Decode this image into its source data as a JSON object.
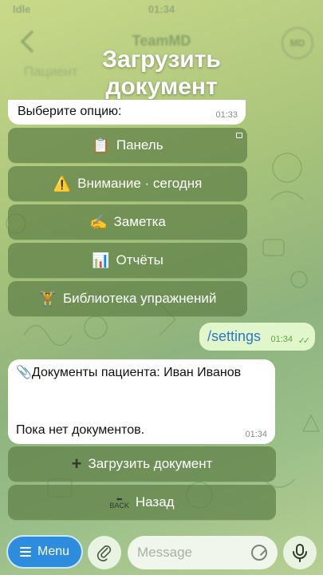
{
  "status_bar": {
    "carrier": "Idle",
    "time": "01:34"
  },
  "header": {
    "title": "TeamMD",
    "avatar_initials": "MD",
    "pinned_hint": "Пациент"
  },
  "overlay": {
    "line1": "Загрузить",
    "line2": "документ"
  },
  "prompt_message": {
    "text": "Выберите опцию:",
    "time": "01:33"
  },
  "menu_keyboard": [
    {
      "emoji": "📋",
      "label": "Панель"
    },
    {
      "emoji": "⚠️",
      "label": "Внимание · сегодня"
    },
    {
      "emoji": "✍️",
      "label": "Заметка"
    },
    {
      "emoji": "📊",
      "label": "Отчёты"
    },
    {
      "emoji": "🏋️",
      "label": "Библиотека упражнений"
    }
  ],
  "outgoing_message": {
    "text": "/settings",
    "time": "01:34"
  },
  "documents_message": {
    "title_emoji": "📎",
    "title": "Документы пациента: Иван Иванов",
    "body": "Пока нет документов.",
    "time": "01:34"
  },
  "docs_keyboard": {
    "upload_label": "Загрузить документ",
    "upload_icon": "+",
    "back_label": "Назад",
    "back_icon": "BACK"
  },
  "input_bar": {
    "menu_label": "Menu",
    "placeholder": "Message"
  },
  "colors": {
    "menu_button": "#2d8cde",
    "keyboard_button": "#5e8046",
    "outgoing_bubble": "#e1f7cb",
    "link": "#2c78c8"
  }
}
